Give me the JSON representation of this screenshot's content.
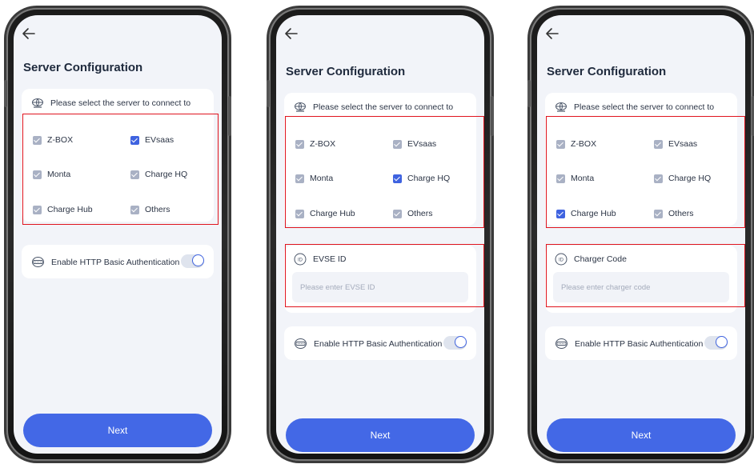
{
  "phones": [
    {
      "title": "Server Configuration",
      "server_prompt": "Please select the server to connect to",
      "servers": [
        {
          "label": "Z-BOX",
          "selected": false
        },
        {
          "label": "EVsaas",
          "selected": true
        },
        {
          "label": "Monta",
          "selected": false
        },
        {
          "label": "Charge HQ",
          "selected": false
        },
        {
          "label": "Charge Hub",
          "selected": false
        },
        {
          "label": "Others",
          "selected": false
        }
      ],
      "auth_label": "Enable HTTP Basic Authentication",
      "next_label": "Next"
    },
    {
      "title": "Server Configuration",
      "server_prompt": "Please select the server to connect to",
      "servers": [
        {
          "label": "Z-BOX",
          "selected": false
        },
        {
          "label": "EVsaas",
          "selected": false
        },
        {
          "label": "Monta",
          "selected": false
        },
        {
          "label": "Charge HQ",
          "selected": true
        },
        {
          "label": "Charge Hub",
          "selected": false
        },
        {
          "label": "Others",
          "selected": false
        }
      ],
      "id_field": {
        "label": "EVSE ID",
        "placeholder": "Please enter EVSE ID",
        "value": ""
      },
      "auth_label": "Enable HTTP Basic Authentication",
      "next_label": "Next"
    },
    {
      "title": "Server Configuration",
      "server_prompt": "Please select the server to connect to",
      "servers": [
        {
          "label": "Z-BOX",
          "selected": false
        },
        {
          "label": "EVsaas",
          "selected": false
        },
        {
          "label": "Monta",
          "selected": false
        },
        {
          "label": "Charge HQ",
          "selected": false
        },
        {
          "label": "Charge Hub",
          "selected": true
        },
        {
          "label": "Others",
          "selected": false
        }
      ],
      "id_field": {
        "label": "Charger Code",
        "placeholder": "Please enter charger code",
        "value": ""
      },
      "auth_label": "Enable HTTP Basic Authentication",
      "next_label": "Next"
    }
  ],
  "colors": {
    "accent": "#4368e6",
    "checkbox_checked": "#3f63e0",
    "checkbox_unchecked": "#a9b1c4",
    "highlight_box": "#e0141e",
    "screen_background": "#f2f4f9"
  },
  "icons": {
    "back": "back-arrow-icon",
    "server": "globe-icon",
    "auth": "http-icon",
    "id": "id-badge-icon"
  }
}
